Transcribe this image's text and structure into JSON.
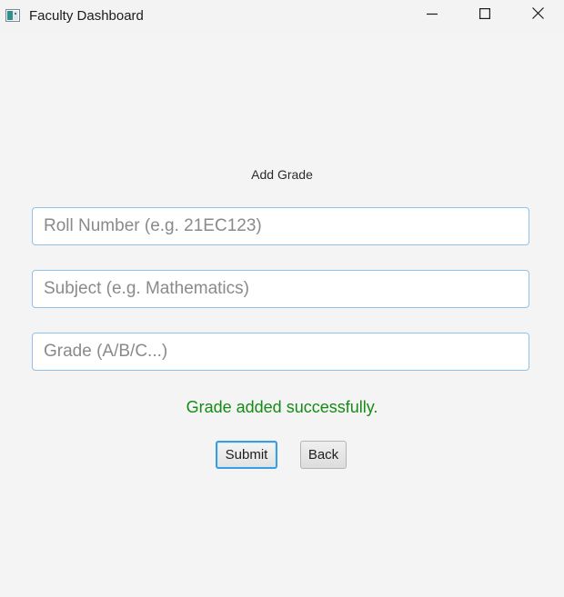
{
  "window": {
    "title": "Faculty Dashboard",
    "controls": {
      "minimize": "minimize-icon",
      "maximize": "maximize-icon",
      "close": "close-icon"
    }
  },
  "form": {
    "title": "Add Grade",
    "roll_number": {
      "value": "",
      "placeholder": "Roll Number (e.g. 21EC123)"
    },
    "subject": {
      "value": "",
      "placeholder": "Subject (e.g. Mathematics)"
    },
    "grade": {
      "value": "",
      "placeholder": "Grade (A/B/C...)"
    },
    "status_message": "Grade added successfully.",
    "submit_label": "Submit",
    "back_label": "Back"
  },
  "colors": {
    "accent_focus": "#3d9be0",
    "field_border": "#8fc2ea",
    "success": "#168a16",
    "background": "#f4f4f4"
  }
}
